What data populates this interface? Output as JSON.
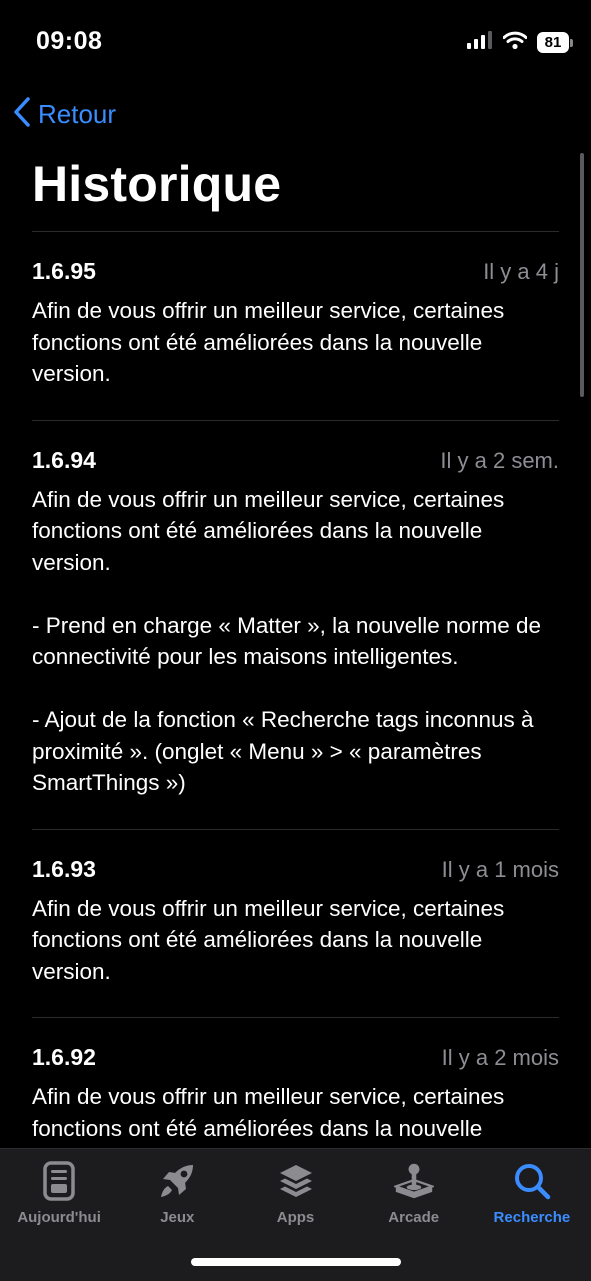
{
  "status_bar": {
    "time": "09:08",
    "battery": "81"
  },
  "nav": {
    "back_label": "Retour"
  },
  "page": {
    "title": "Historique"
  },
  "history": [
    {
      "version": "1.6.95",
      "date": "Il y a 4 j",
      "notes": [
        "Afin de vous offrir un meilleur service, certaines fonctions ont été améliorées dans la nouvelle version."
      ]
    },
    {
      "version": "1.6.94",
      "date": "Il y a 2 sem.",
      "notes": [
        "Afin de vous offrir un meilleur service, certaines fonctions ont été améliorées dans la nouvelle version.",
        "- Prend en charge « Matter », la nouvelle norme de connectivité pour les maisons intelligentes.",
        "- Ajout de la fonction « Recherche tags inconnus à proximité ». (onglet « Menu » > « paramètres SmartThings »)"
      ]
    },
    {
      "version": "1.6.93",
      "date": "Il y a 1 mois",
      "notes": [
        "Afin de vous offrir un meilleur service, certaines fonctions ont été améliorées dans la nouvelle version."
      ]
    },
    {
      "version": "1.6.92",
      "date": "Il y a 2 mois",
      "notes": [
        "Afin de vous offrir un meilleur service, certaines fonctions ont été améliorées dans la nouvelle version."
      ]
    }
  ],
  "tab_bar": {
    "active_color": "#3a8cff",
    "tabs": [
      {
        "label": "Aujourd'hui",
        "icon": "today-icon",
        "active": false
      },
      {
        "label": "Jeux",
        "icon": "rocket-icon",
        "active": false
      },
      {
        "label": "Apps",
        "icon": "apps-stack-icon",
        "active": false
      },
      {
        "label": "Arcade",
        "icon": "joystick-icon",
        "active": false
      },
      {
        "label": "Recherche",
        "icon": "search-icon",
        "active": true
      }
    ]
  }
}
